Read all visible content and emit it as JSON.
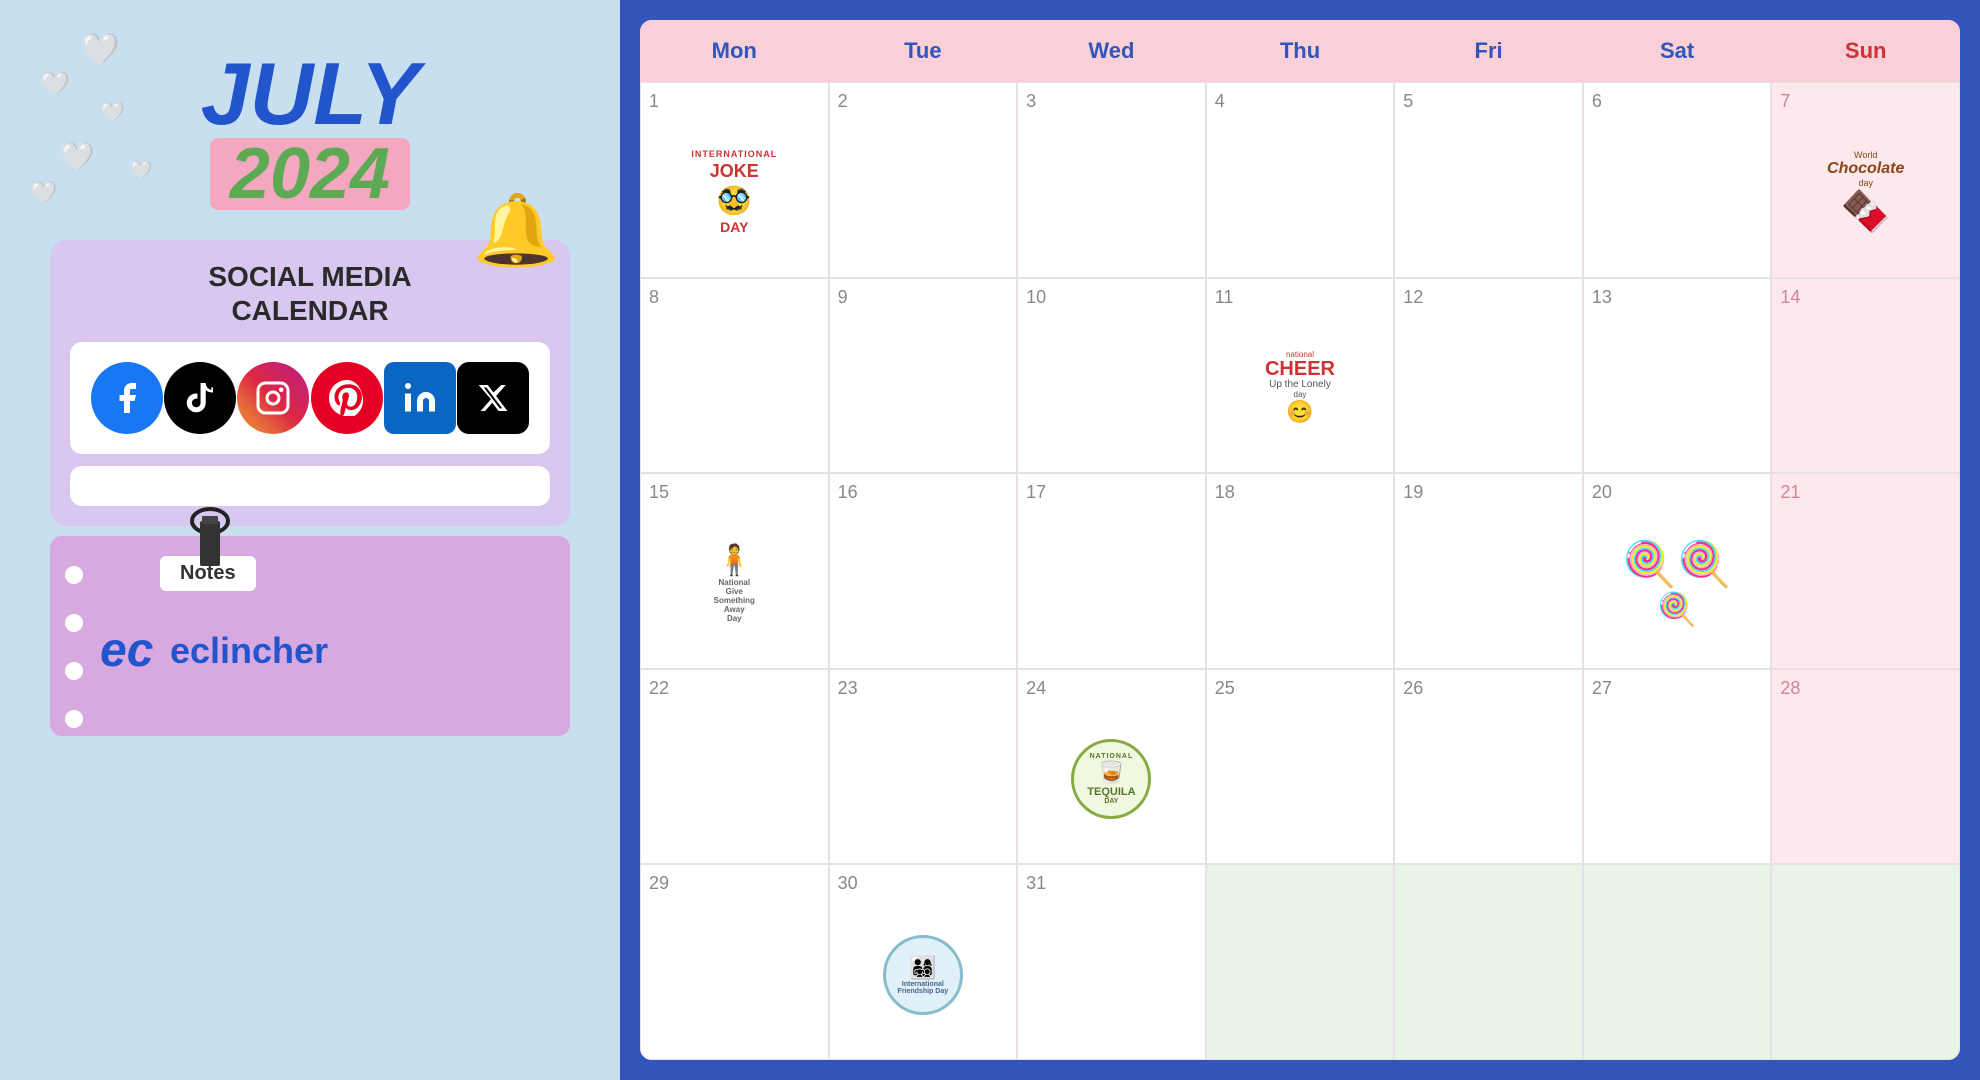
{
  "left": {
    "month": "JULY",
    "year": "2024",
    "section_title": "SOCIAL MEDIA\nCALENDAR",
    "notes_label": "Notes",
    "brand_name": "eclincher",
    "social_platforms": [
      "Facebook",
      "TikTok",
      "Instagram",
      "Pinterest",
      "LinkedIn",
      "X/Twitter"
    ]
  },
  "calendar": {
    "title": "July 2024 Social Media Calendar",
    "headers": [
      "Mon",
      "Tue",
      "Wed",
      "Thu",
      "Fri",
      "Sat",
      "Sun"
    ],
    "events": {
      "1": "International Joke Day",
      "7": "World Chocolate Day",
      "11": "National Cheer Up the Lonely Day",
      "15": "National Give Something Away Day",
      "20": "Lollipop Day",
      "24": "National Tequila Day",
      "30": "International Friendship Day"
    },
    "weeks": [
      [
        {
          "day": "1",
          "type": "mon",
          "event": "joke-day"
        },
        {
          "day": "2",
          "type": "tue",
          "event": null
        },
        {
          "day": "3",
          "type": "wed",
          "event": null
        },
        {
          "day": "4",
          "type": "thu",
          "event": null
        },
        {
          "day": "5",
          "type": "fri",
          "event": null
        },
        {
          "day": "6",
          "type": "sat",
          "event": null
        },
        {
          "day": "7",
          "type": "sun",
          "event": "chocolate-day"
        }
      ],
      [
        {
          "day": "8",
          "type": "mon",
          "event": null
        },
        {
          "day": "9",
          "type": "tue",
          "event": null
        },
        {
          "day": "10",
          "type": "wed",
          "event": null
        },
        {
          "day": "11",
          "type": "thu",
          "event": "cheer-day"
        },
        {
          "day": "12",
          "type": "fri",
          "event": null
        },
        {
          "day": "13",
          "type": "sat",
          "event": null
        },
        {
          "day": "14",
          "type": "sun",
          "event": null
        }
      ],
      [
        {
          "day": "15",
          "type": "mon",
          "event": "giveaway-day"
        },
        {
          "day": "16",
          "type": "tue",
          "event": null
        },
        {
          "day": "17",
          "type": "wed",
          "event": null
        },
        {
          "day": "18",
          "type": "thu",
          "event": null
        },
        {
          "day": "19",
          "type": "fri",
          "event": null
        },
        {
          "day": "20",
          "type": "sat",
          "event": "lollipop-day"
        },
        {
          "day": "21",
          "type": "sun",
          "event": null
        }
      ],
      [
        {
          "day": "22",
          "type": "mon",
          "event": null
        },
        {
          "day": "23",
          "type": "tue",
          "event": null
        },
        {
          "day": "24",
          "type": "wed",
          "event": "tequila-day"
        },
        {
          "day": "25",
          "type": "thu",
          "event": null
        },
        {
          "day": "26",
          "type": "fri",
          "event": null
        },
        {
          "day": "27",
          "type": "sat",
          "event": null
        },
        {
          "day": "28",
          "type": "sun",
          "event": null
        }
      ],
      [
        {
          "day": "29",
          "type": "mon",
          "event": null
        },
        {
          "day": "30",
          "type": "tue",
          "event": "friendship-day"
        },
        {
          "day": "31",
          "type": "wed",
          "event": null
        },
        {
          "day": "",
          "type": "empty",
          "event": null
        },
        {
          "day": "",
          "type": "empty",
          "event": null
        },
        {
          "day": "",
          "type": "empty",
          "event": null
        },
        {
          "day": "",
          "type": "empty",
          "event": null
        }
      ]
    ]
  }
}
